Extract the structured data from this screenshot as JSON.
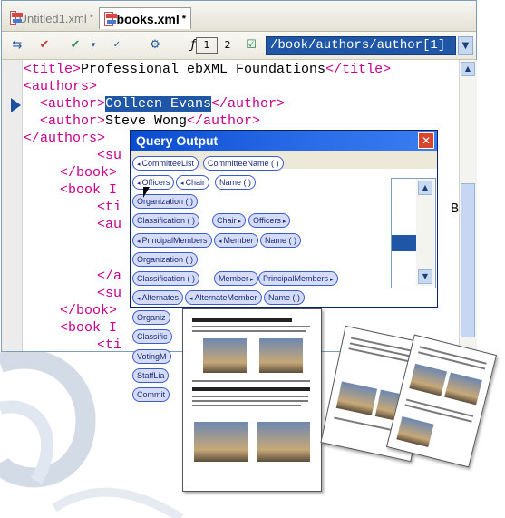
{
  "tabs": [
    {
      "label": "Untitled1.xml",
      "modified": "*",
      "active": false
    },
    {
      "label": "books.xml",
      "modified": "*",
      "active": true
    }
  ],
  "toolbar": {
    "xpath_value": "/book/authors/author[1]",
    "xpath_version_1": "1",
    "xpath_version_2": "2"
  },
  "code_lines": [
    {
      "tag1": "<title>",
      "text": "Professional ebXML Foundations",
      "tag2": "</title>"
    },
    {
      "tag1": "<authors>"
    },
    {
      "tag1": "<author>",
      "text": "Colleen Evans",
      "tag2": "</author>"
    },
    {
      "tag1": "<author>",
      "text": "Steve Wong",
      "tag2": "</author>"
    },
    {
      "tag1": "</authors>",
      "text_after": "<su"
    },
    {
      "tag1": "</book>"
    },
    {
      "tag1": "<book I"
    },
    {
      "tag1": "<ti"
    },
    {
      "tag1": "<au"
    },
    {
      "tag1": "</a"
    },
    {
      "tag1": "<su"
    },
    {
      "tag1": "</book>"
    },
    {
      "tag1": "<book I"
    },
    {
      "tag1": "<ti"
    }
  ],
  "editor_overflow_char": "B",
  "query_output": {
    "title": "Query Output",
    "close_glyph": "✕"
  },
  "pills": [
    "CommitteeList",
    "CommitteeName",
    "Officers",
    "Chair",
    "Name",
    "Organization",
    "Classification",
    "Chair",
    "Officers",
    "PrincipalMembers",
    "Member",
    "Name",
    "Organization",
    "Classification",
    "Member",
    "PrincipalMembers",
    "Alternates",
    "AlternateMember",
    "Name",
    "Organiz",
    "Classific",
    "VotingM",
    "StaffLia",
    "Commit"
  ],
  "colors": {
    "accent": "#1f56a6",
    "tag": "#c8008a",
    "pill_border": "#3c5ad0"
  }
}
